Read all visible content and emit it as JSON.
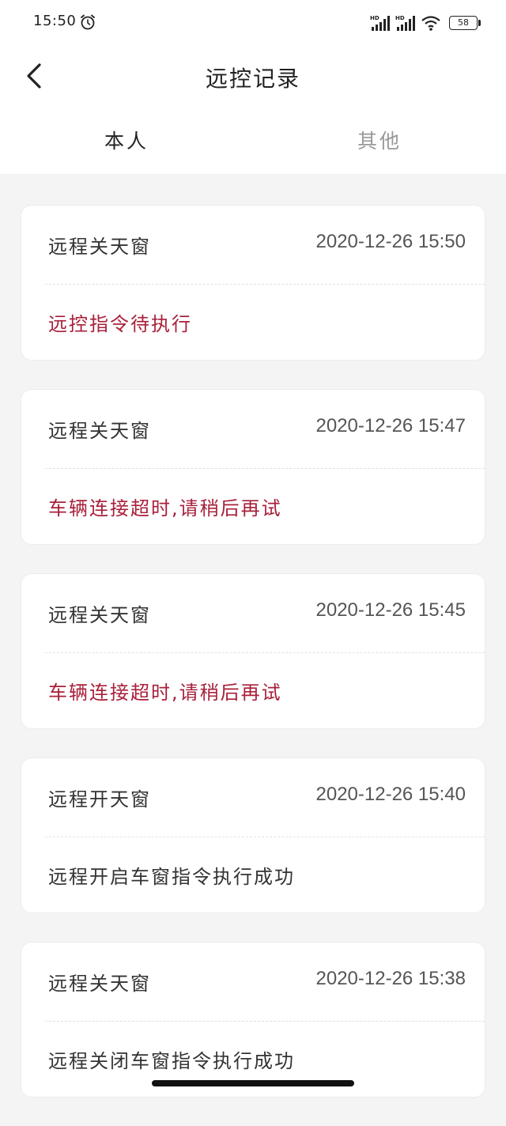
{
  "status_bar": {
    "time": "15:50",
    "battery": "58"
  },
  "header": {
    "title": "远控记录"
  },
  "tabs": [
    {
      "label": "本人"
    },
    {
      "label": "其他"
    }
  ],
  "records": [
    {
      "title": "远程关天窗",
      "time": "2020-12-26 15:50",
      "status": "远控指令待执行",
      "status_color": "#a8203a"
    },
    {
      "title": "远程关天窗",
      "time": "2020-12-26 15:47",
      "status": "车辆连接超时,请稍后再试",
      "status_color": "#a8203a"
    },
    {
      "title": "远程关天窗",
      "time": "2020-12-26 15:45",
      "status": "车辆连接超时,请稍后再试",
      "status_color": "#a8203a"
    },
    {
      "title": "远程开天窗",
      "time": "2020-12-26 15:40",
      "status": "远程开启车窗指令执行成功",
      "status_color": "#333333"
    },
    {
      "title": "远程关天窗",
      "time": "2020-12-26 15:38",
      "status": "远程关闭车窗指令执行成功",
      "status_color": "#333333"
    }
  ]
}
